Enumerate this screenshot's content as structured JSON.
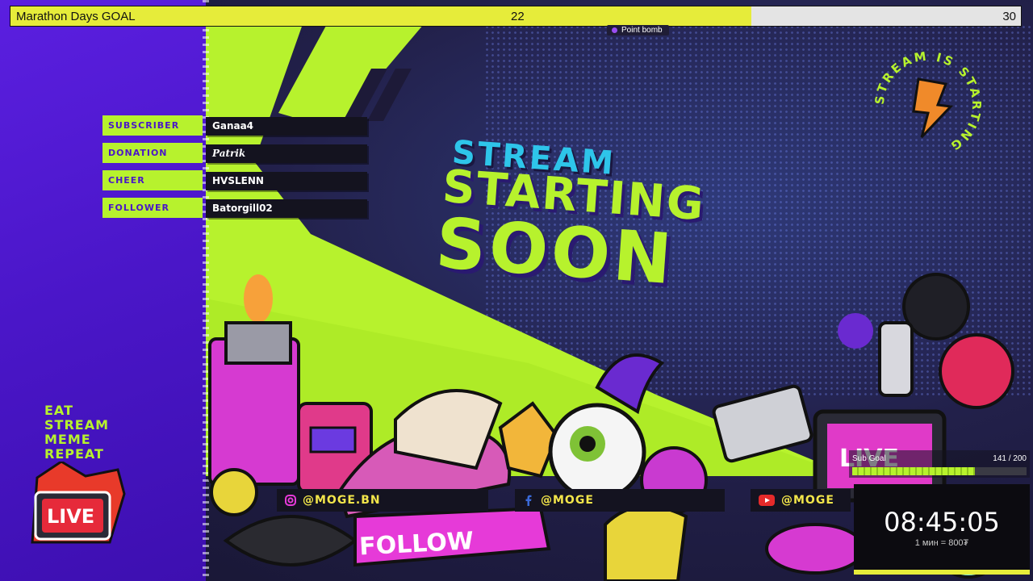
{
  "goal": {
    "title": "Marathon Days GOAL",
    "current": "22",
    "target": "30",
    "progress": 0.733
  },
  "point_bomb": {
    "label": "Point bomb"
  },
  "events": [
    {
      "label": "SUBSCRIBER",
      "value": "Ganaa4"
    },
    {
      "label": "DONATION",
      "value": "Patrik"
    },
    {
      "label": "CHEER",
      "value": "HVSLENN"
    },
    {
      "label": "FOLLOWER",
      "value": "Batorgill02"
    }
  ],
  "slogan": [
    "EAT",
    "STREAM",
    "MEME",
    "REPEAT"
  ],
  "title": {
    "line1": "STREAM",
    "line2": "STARTING",
    "line3": "SOON"
  },
  "badge_ring_text": "STREAM IS STARTING",
  "stickers": {
    "live": "LIVE",
    "follow": "FOLLOW"
  },
  "social": [
    {
      "icon": "instagram-icon",
      "handle": "@MOGE.BN"
    },
    {
      "icon": "facebook-icon",
      "handle": "@MOGE"
    },
    {
      "icon": "youtube-icon",
      "handle": "@MOGE"
    }
  ],
  "sub_goal": {
    "label": "Sub Goal",
    "count": "141 / 200",
    "progress": 0.705
  },
  "timer": {
    "time": "08:45:05",
    "rate": "1 мин = 800₮"
  },
  "colors": {
    "lime": "#b7f22d",
    "purple": "#4a16c8",
    "cyan": "#2ec5ea",
    "magenta": "#e63ad8",
    "yellow": "#e6ec3a"
  }
}
